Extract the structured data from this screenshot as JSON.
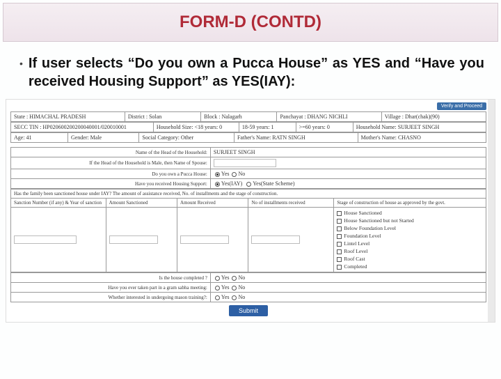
{
  "header": {
    "title": "FORM-D (CONTD)"
  },
  "bullet": {
    "text": "If user selects “Do you own a Pucca House” as YES and “Have you received Housing Support” as YES(IAY):"
  },
  "top_button": "Verify and Proceed",
  "row1": {
    "state_l": "State :",
    "state_v": "HIMACHAL PRADESH",
    "district_l": "District :",
    "district_v": "Solan",
    "block_l": "Block :",
    "block_v": "Nalagarh",
    "panch_l": "Panchayat :",
    "panch_v": "DHANG NICHLI",
    "village_l": "Village :",
    "village_v": "Dhar(chak)(90)"
  },
  "row2": {
    "secc_l": "SECC TIN :",
    "secc_v": "HP020600200200040001/020010001",
    "hh_lt18_l": "Household Size: <18 years:",
    "hh_lt18_v": "0",
    "hh_1859_l": "18-59 years:",
    "hh_1859_v": "1",
    "hh_60_l": ">=60 years:",
    "hh_60_v": "0",
    "hh_name_l": "Household Name:",
    "hh_name_v": "SURJEET SINGH"
  },
  "row3": {
    "age_l": "Age:",
    "age_v": "41",
    "gender_l": "Gender:",
    "gender_v": "Male",
    "soc_l": "Social Category:",
    "soc_v": "Other",
    "father_l": "Father's Name:",
    "father_v": "RATN SINGH",
    "mother_l": "Mother's Name:",
    "mother_v": "CHASNO"
  },
  "q": {
    "head_name_l": "Name of the Head of the Household:",
    "head_name_v": "SURJEET SINGH",
    "spouse_l": "If the Head of the Household is Male, then Name of Spouse:",
    "pucca_l": "Do you own a Pucca House:",
    "pucca_yes": "Yes",
    "pucca_no": "No",
    "support_l": "Have you received Housing Support:",
    "support_yes": "Yes(IAY)",
    "support_state": "Yes(State Scheme)"
  },
  "iay": {
    "heading": "Has the family been sanctioned house under IAY? The amount of assistance received, No. of installments and the stage of construction.",
    "c1": "Sanction Number (if any) & Year of sanction",
    "c2": "Amount Sanctioned",
    "c3": "Amount Received",
    "c4": "No of installments received",
    "c5": "Stage of construction of house as approved by the govt."
  },
  "stages": [
    "House Sanctioned",
    "House Sanctioned but not Started",
    "Below Foundation Level",
    "Foundation Level",
    "Lintel Level",
    "Roof Level",
    "Roof Cast",
    "Completed"
  ],
  "q2": {
    "completed_l": "Is the house completed ?",
    "gram_l": "Have you ever taken part in a gram sabha meeting:",
    "mason_l": "Whether interested in undergoing mason training?:",
    "yes": "Yes",
    "no": "No"
  },
  "submit": "Submit"
}
